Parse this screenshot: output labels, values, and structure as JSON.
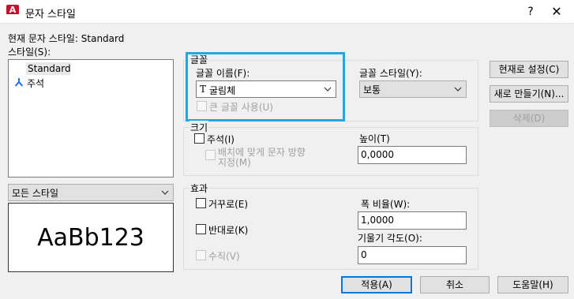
{
  "window": {
    "title": "문자 스타일",
    "app_icon_letter": "A",
    "help_symbol": "?",
    "close_symbol": "✕"
  },
  "current_style": "현재 문자 스타일: Standard",
  "styles_label": "스타일(S):",
  "styles_list": [
    "Standard",
    "주석"
  ],
  "filter_select": "모든 스타일",
  "preview_text": "AaBb123",
  "font_group": {
    "title": "글꼴",
    "font_name_label": "글꼴 이름(F):",
    "font_name_value": "굴림체",
    "font_type_glyph": "T",
    "big_font_label": "큰 글꼴 사용(U)",
    "font_style_label": "글꼴 스타일(Y):",
    "font_style_value": "보통"
  },
  "size_group": {
    "title": "크기",
    "annotative_label": "주석(I)",
    "match_layout_label_line1": "배치에 맞게 문자 방향",
    "match_layout_label_line2": "지정(M)",
    "height_label": "높이(T)",
    "height_value": "0,0000"
  },
  "effects_group": {
    "title": "효과",
    "upside_down_label": "거꾸로(E)",
    "backwards_label": "반대로(K)",
    "vertical_label": "수직(V)",
    "width_factor_label": "폭 비율(W):",
    "width_factor_value": "1,0000",
    "oblique_label": "기울기 각도(O):",
    "oblique_value": "0"
  },
  "buttons": {
    "set_current": "현재로 설정(C)",
    "new": "새로 만들기(N)...",
    "delete": "삭제(D)",
    "apply": "적용(A)",
    "cancel": "취소",
    "help": "도움말(H)"
  }
}
